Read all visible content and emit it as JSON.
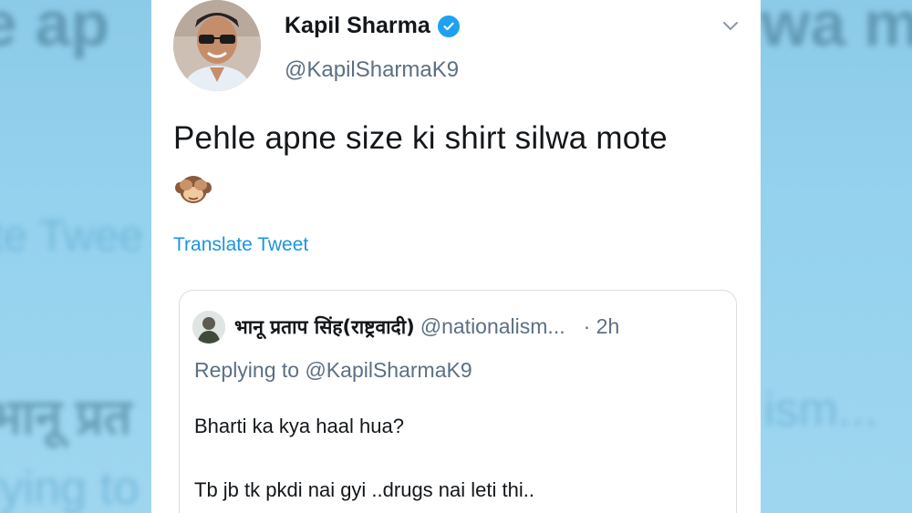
{
  "background": {
    "left_ghost_text": [
      "e ap",
      "te Twee",
      "भानू प्रत",
      "lying to"
    ],
    "right_ghost_text": [
      "wa m",
      "ism...",
      "",
      ""
    ]
  },
  "tweet": {
    "author_name": "Kapil Sharma",
    "author_handle": "@KapilSharmaK9",
    "verified": true,
    "text": "Pehle apne size ki shirt silwa mote",
    "emoji": "see-no-evil-monkey",
    "translate_label": "Translate Tweet"
  },
  "quoted_tweet": {
    "author_name": "भानू प्रताप सिंह(राष्ट्रवादी)",
    "author_handle": "@nationalism...",
    "time": "· 2h",
    "replying_to": "Replying to @KapilSharmaK9",
    "body_line1": "Bharti ka kya haal hua?",
    "body_line2": "Tb jb tk pkdi nai gyi ..drugs nai leti thi.."
  },
  "colors": {
    "accent": "#1da1f2",
    "link": "#1b95e0",
    "muted": "#5b7083",
    "text": "#14171a",
    "backdrop": "#8fd0ec"
  }
}
